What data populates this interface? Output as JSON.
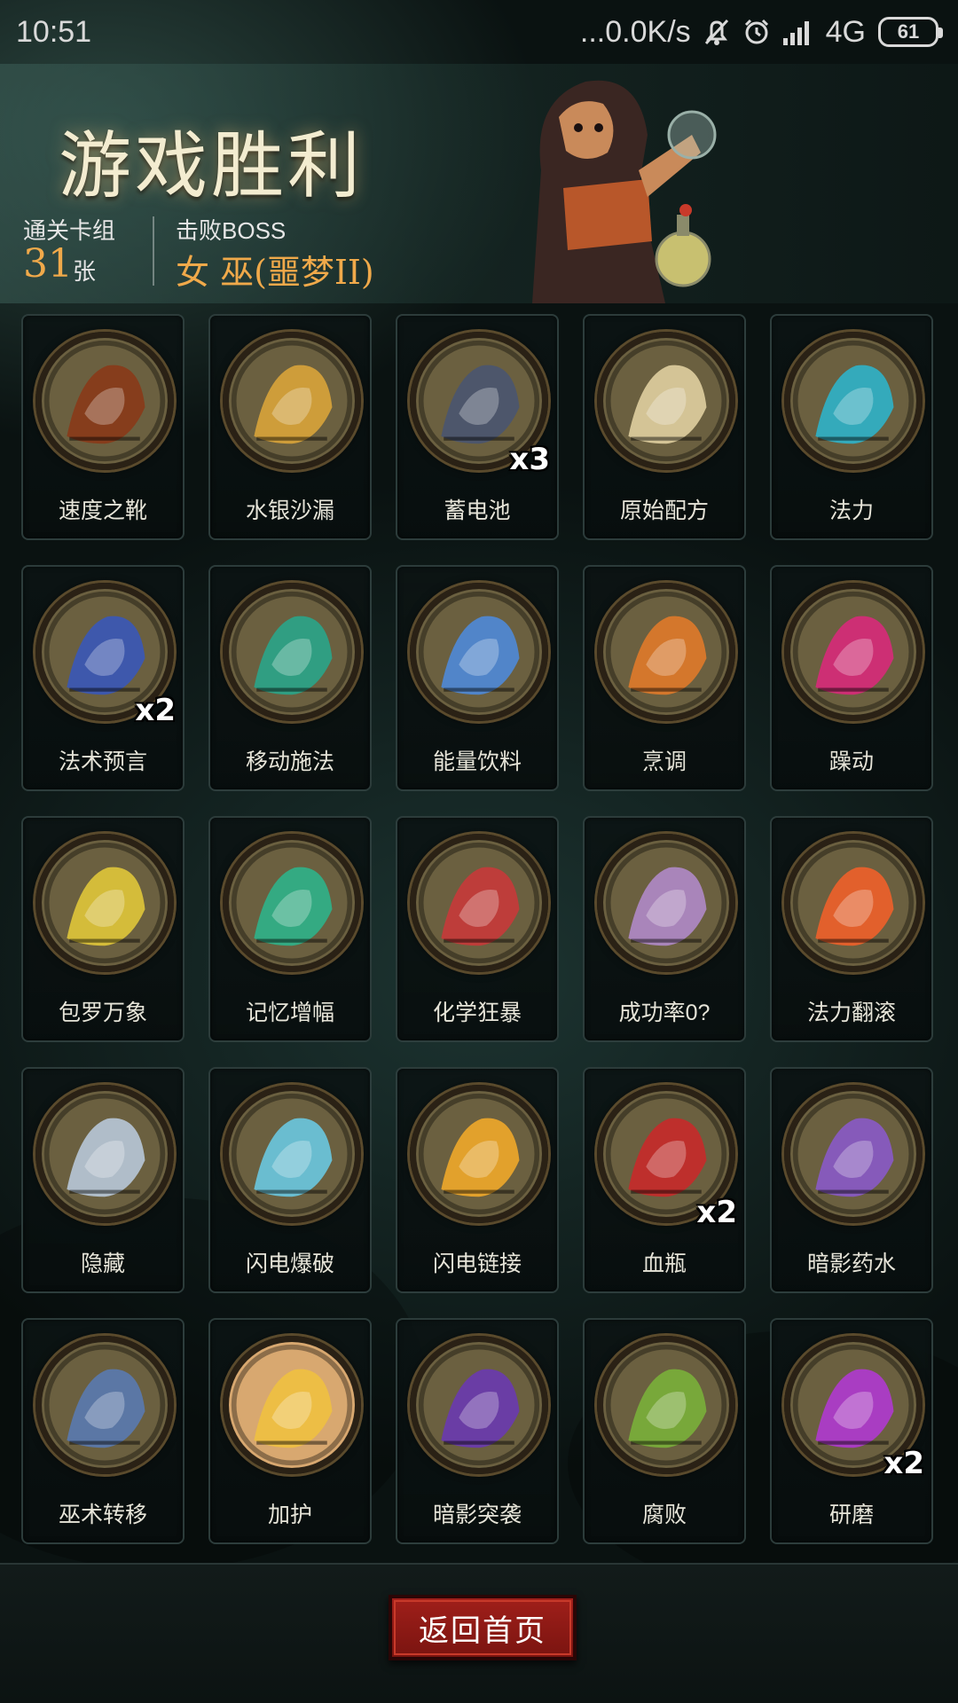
{
  "status_bar": {
    "time": "10:51",
    "network_speed": "...0.0K/s",
    "network_type": "4G",
    "battery": "61",
    "icons": [
      "mute-bell-icon",
      "alarm-icon",
      "signal-icon"
    ]
  },
  "header": {
    "title": "游戏胜利",
    "deck_label": "通关卡组",
    "deck_count": "31",
    "deck_unit": "张",
    "boss_label": "击败BOSS",
    "boss_name": "女 巫(噩梦II)"
  },
  "cards": [
    {
      "label": "速度之靴",
      "count": "",
      "icon": "boot-icon",
      "bg": "#6b6040",
      "accent": "#8a3a18"
    },
    {
      "label": "水银沙漏",
      "count": "",
      "icon": "hourglass-icon",
      "bg": "#6b6040",
      "accent": "#d9a43a"
    },
    {
      "label": "蓄电池",
      "count": "x3",
      "icon": "battery-box-icon",
      "bg": "#6b6040",
      "accent": "#4a5570"
    },
    {
      "label": "原始配方",
      "count": "",
      "icon": "scroll-icon",
      "bg": "#6b6040",
      "accent": "#e0cfa0"
    },
    {
      "label": "法力",
      "count": "",
      "icon": "mana-orb-icon",
      "bg": "#6b6040",
      "accent": "#2fb3c9"
    },
    {
      "label": "法术预言",
      "count": "x2",
      "icon": "crystal-ball-icon",
      "bg": "#6b6040",
      "accent": "#3a58b8"
    },
    {
      "label": "移动施法",
      "count": "",
      "icon": "wizard-icon",
      "bg": "#6b6040",
      "accent": "#2aa58a"
    },
    {
      "label": "能量饮料",
      "count": "",
      "icon": "energy-drink-icon",
      "bg": "#6b6040",
      "accent": "#4f8ad8"
    },
    {
      "label": "烹调",
      "count": "",
      "icon": "fox-chef-icon",
      "bg": "#6b6040",
      "accent": "#e07a2a"
    },
    {
      "label": "躁动",
      "count": "",
      "icon": "frenzy-icon",
      "bg": "#6b6040",
      "accent": "#d82a7a"
    },
    {
      "label": "包罗万象",
      "count": "",
      "icon": "cards-icon",
      "bg": "#6b6040",
      "accent": "#e0c63a"
    },
    {
      "label": "记忆增幅",
      "count": "",
      "icon": "brain-icon",
      "bg": "#6b6040",
      "accent": "#2fb38a"
    },
    {
      "label": "化学狂暴",
      "count": "",
      "icon": "berserker-icon",
      "bg": "#6b6040",
      "accent": "#c83a3a"
    },
    {
      "label": "成功率0?",
      "count": "",
      "icon": "cage-icon",
      "bg": "#6b6040",
      "accent": "#b08ac8"
    },
    {
      "label": "法力翻滚",
      "count": "",
      "icon": "fire-bowl-icon",
      "bg": "#6b6040",
      "accent": "#f0602a"
    },
    {
      "label": "隐藏",
      "count": "",
      "icon": "door-icon",
      "bg": "#6b6040",
      "accent": "#b8c8d8"
    },
    {
      "label": "闪电爆破",
      "count": "",
      "icon": "lightning-blast-icon",
      "bg": "#6b6040",
      "accent": "#6ac8e0"
    },
    {
      "label": "闪电链接",
      "count": "",
      "icon": "lightning-chain-icon",
      "bg": "#6b6040",
      "accent": "#f0a82a"
    },
    {
      "label": "血瓶",
      "count": "x2",
      "icon": "blood-potion-icon",
      "bg": "#6b6040",
      "accent": "#c82a2a"
    },
    {
      "label": "暗影药水",
      "count": "",
      "icon": "reaper-potion-icon",
      "bg": "#6b6040",
      "accent": "#8a5ac8"
    },
    {
      "label": "巫术转移",
      "count": "",
      "icon": "old-wizard-icon",
      "bg": "#6b6040",
      "accent": "#5a7ab0"
    },
    {
      "label": "加护",
      "count": "",
      "icon": "shield-orb-icon",
      "bg": "#d8a870",
      "accent": "#f0c040"
    },
    {
      "label": "暗影突袭",
      "count": "",
      "icon": "reaper-icon",
      "bg": "#6b6040",
      "accent": "#6a3ab0"
    },
    {
      "label": "腐败",
      "count": "",
      "icon": "skull-icon",
      "bg": "#6b6040",
      "accent": "#7ab03a"
    },
    {
      "label": "研磨",
      "count": "x2",
      "icon": "grinder-icon",
      "bg": "#6b6040",
      "accent": "#b03ad0"
    }
  ],
  "footer": {
    "home_button_label": "返回首页"
  }
}
